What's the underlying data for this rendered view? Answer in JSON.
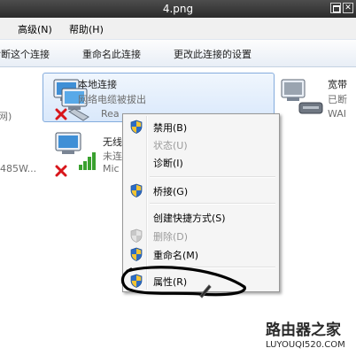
{
  "window": {
    "title": "4.png"
  },
  "menubar": {
    "items": [
      "高级(N)",
      "帮助(H)"
    ]
  },
  "toolbar": {
    "buttons": [
      "诊断这个连接",
      "重命名此连接",
      "更改此连接的设置"
    ]
  },
  "connections": {
    "left_partial": {
      "status": "网)",
      "device": "485W..."
    },
    "local": {
      "name": "本地连接",
      "status": "网络电缆被拔出",
      "device": "Rea"
    },
    "wireless": {
      "name": "无线",
      "status": "未连",
      "device": "Mic"
    },
    "broadband": {
      "name": "宽带",
      "status": "已断",
      "device": "WAI"
    }
  },
  "context_menu": {
    "items": [
      {
        "label": "禁用(B)",
        "enabled": true,
        "shield": true
      },
      {
        "label": "状态(U)",
        "enabled": false,
        "shield": false
      },
      {
        "label": "诊断(I)",
        "enabled": true,
        "shield": false
      },
      {
        "label": "桥接(G)",
        "enabled": true,
        "shield": true
      },
      {
        "label": "创建快捷方式(S)",
        "enabled": true,
        "shield": false
      },
      {
        "label": "删除(D)",
        "enabled": false,
        "shield": true
      },
      {
        "label": "重命名(M)",
        "enabled": true,
        "shield": true
      },
      {
        "label": "属性(R)",
        "enabled": true,
        "shield": true
      }
    ]
  },
  "watermark": {
    "text": "路由器之家",
    "url": "LUYOUQI520.COM"
  },
  "colors": {
    "selection_border": "#84acdd",
    "selection_fill": "#d9e8fb",
    "error_red": "#d8161b",
    "signal_green": "#3aa12f",
    "shield_blue": "#2d6cc4",
    "shield_yellow": "#f4c431",
    "annotation_ink": "#000000"
  }
}
